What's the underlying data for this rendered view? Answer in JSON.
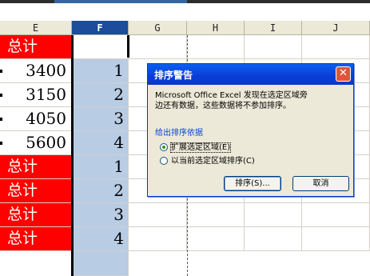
{
  "columns": [
    {
      "id": "E",
      "label": "E",
      "selected": false
    },
    {
      "id": "F",
      "label": "F",
      "selected": true
    },
    {
      "id": "G",
      "label": "G",
      "selected": false
    },
    {
      "id": "H",
      "label": "H",
      "selected": false
    },
    {
      "id": "I",
      "label": "I",
      "selected": false
    },
    {
      "id": "J",
      "label": "J",
      "selected": false
    }
  ],
  "rows": [
    {
      "e": "总计",
      "e_type": "red",
      "f": ""
    },
    {
      "e": "3400",
      "e_type": "num",
      "f": "1"
    },
    {
      "e": "3150",
      "e_type": "num",
      "f": "2"
    },
    {
      "e": "4050",
      "e_type": "num",
      "f": "3"
    },
    {
      "e": "5600",
      "e_type": "num",
      "f": "4"
    },
    {
      "e": "总计",
      "e_type": "red",
      "f": "1"
    },
    {
      "e": "总计",
      "e_type": "red",
      "f": "2"
    },
    {
      "e": "总计",
      "e_type": "red",
      "f": "3"
    },
    {
      "e": "总计",
      "e_type": "red",
      "f": "4"
    }
  ],
  "colors": {
    "header_selected": "#1c4c9a",
    "selection_fill": "#b8cce4",
    "total_fill": "#ff0000",
    "dialog_title_bar": "#0a5ff0"
  },
  "dialog": {
    "title": "排序警告",
    "close_icon": "close-icon",
    "message_line1": "Microsoft Office Excel 发现在选定区域旁",
    "message_line2": "边还有数据，这些数据将不参加排序。",
    "group_label": "给出排序依据",
    "option_expand": "扩展选定区域(E)",
    "option_current": "以当前选定区域排序(C)",
    "option_expand_selected": true,
    "sort_button": "排序(S)...",
    "cancel_button": "取消"
  }
}
